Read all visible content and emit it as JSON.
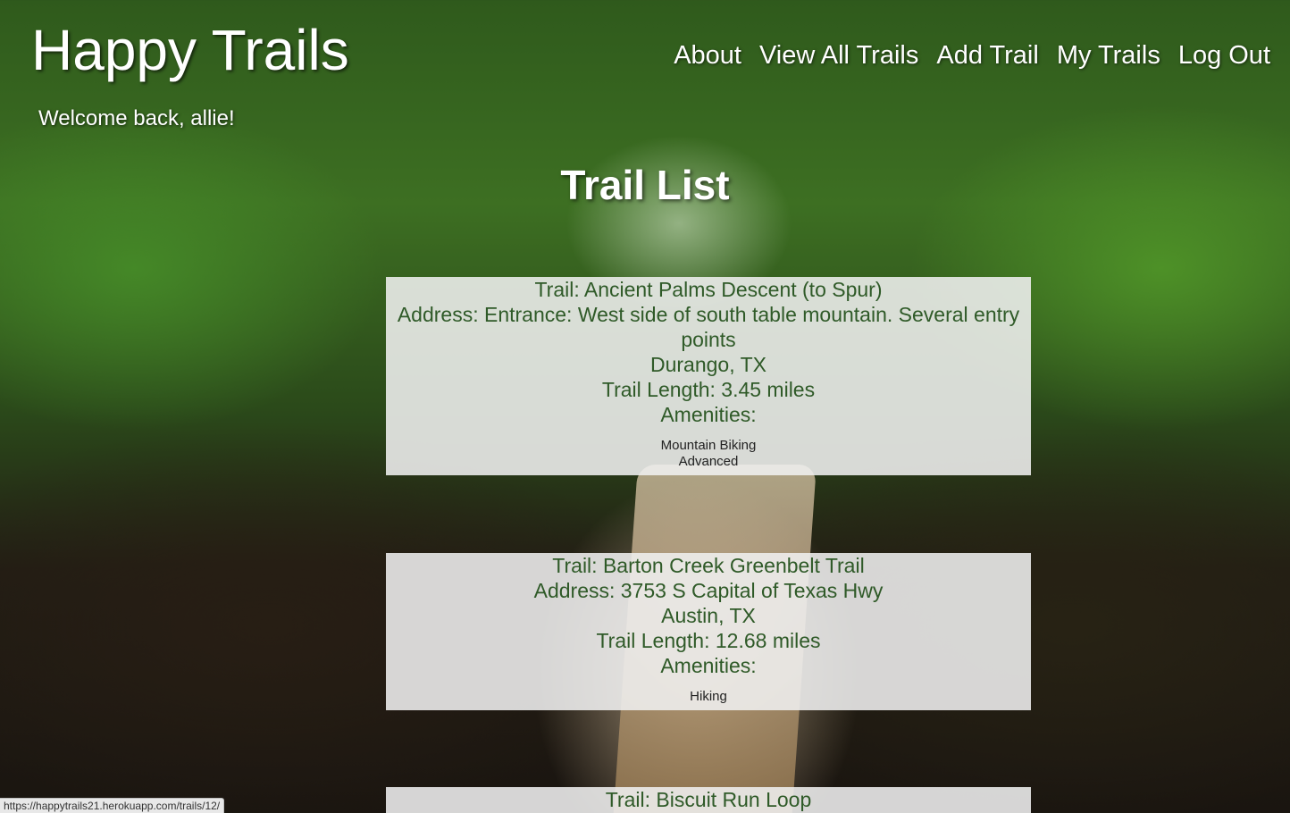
{
  "header": {
    "title": "Happy Trails",
    "welcome": "Welcome back, allie!"
  },
  "nav": {
    "items": [
      "About",
      "View All Trails",
      "Add Trail",
      "My Trails",
      "Log Out"
    ]
  },
  "page_title": "Trail List",
  "trails": [
    {
      "trail": "Trail: Ancient Palms Descent (to Spur)",
      "address": "Address: Entrance: West side of south table mountain. Several entry points",
      "city": "Durango, TX",
      "length": "Trail Length: 3.45 miles",
      "amenities_label": "Amenities:",
      "amenities": [
        "Mountain Biking",
        "Advanced"
      ]
    },
    {
      "trail": "Trail: Barton Creek Greenbelt Trail",
      "address": "Address: 3753 S Capital of Texas Hwy",
      "city": "Austin, TX",
      "length": "Trail Length: 12.68 miles",
      "amenities_label": "Amenities:",
      "amenities": [
        "Hiking"
      ]
    },
    {
      "trail": "Trail: Biscuit Run Loop"
    }
  ],
  "status_bar": {
    "url": "https://happytrails21.herokuapp.com/trails/12/"
  }
}
